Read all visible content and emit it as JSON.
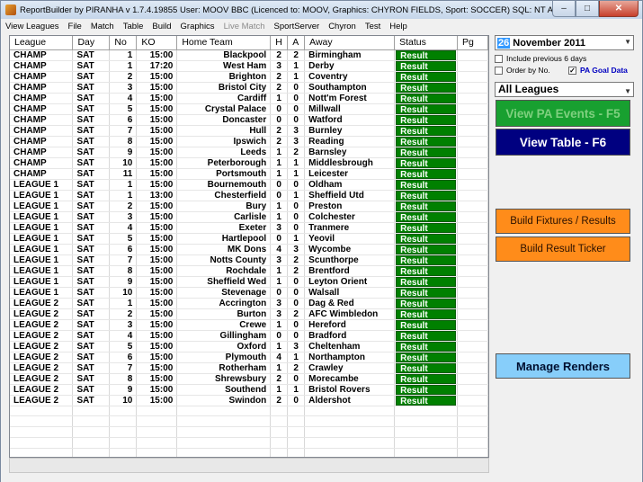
{
  "window": {
    "title": "ReportBuilder by PIRANHA v 1.7.4.19855     User: MOOV BBC   (Licenced to: MOOV, Graphics: CHYRON FIELDS, Sport: SOCCER)     SQL: NT Auth",
    "controls": {
      "minimize": "–",
      "maximize": "□",
      "close": "✕"
    }
  },
  "menu": [
    {
      "label": "View Leagues",
      "disabled": false
    },
    {
      "label": "File",
      "disabled": false
    },
    {
      "label": "Match",
      "disabled": false
    },
    {
      "label": "Table",
      "disabled": false
    },
    {
      "label": "Build",
      "disabled": false
    },
    {
      "label": "Graphics",
      "disabled": false
    },
    {
      "label": "Live Match",
      "disabled": true
    },
    {
      "label": "SportServer",
      "disabled": false
    },
    {
      "label": "Chyron",
      "disabled": false
    },
    {
      "label": "Test",
      "disabled": false
    },
    {
      "label": "Help",
      "disabled": false
    }
  ],
  "grid": {
    "headers": [
      "League",
      "Day",
      "No",
      "KO",
      "Home Team",
      "H",
      "A",
      "Away",
      "Status",
      "Pg"
    ],
    "rows": [
      [
        "CHAMP",
        "SAT",
        "1",
        "15:00",
        "Blackpool",
        "2",
        "2",
        "Birmingham",
        "Result",
        ""
      ],
      [
        "CHAMP",
        "SAT",
        "1",
        "17:20",
        "West Ham",
        "3",
        "1",
        "Derby",
        "Result",
        ""
      ],
      [
        "CHAMP",
        "SAT",
        "2",
        "15:00",
        "Brighton",
        "2",
        "1",
        "Coventry",
        "Result",
        ""
      ],
      [
        "CHAMP",
        "SAT",
        "3",
        "15:00",
        "Bristol City",
        "2",
        "0",
        "Southampton",
        "Result",
        ""
      ],
      [
        "CHAMP",
        "SAT",
        "4",
        "15:00",
        "Cardiff",
        "1",
        "0",
        "Nott'm Forest",
        "Result",
        ""
      ],
      [
        "CHAMP",
        "SAT",
        "5",
        "15:00",
        "Crystal Palace",
        "0",
        "0",
        "Millwall",
        "Result",
        ""
      ],
      [
        "CHAMP",
        "SAT",
        "6",
        "15:00",
        "Doncaster",
        "0",
        "0",
        "Watford",
        "Result",
        ""
      ],
      [
        "CHAMP",
        "SAT",
        "7",
        "15:00",
        "Hull",
        "2",
        "3",
        "Burnley",
        "Result",
        ""
      ],
      [
        "CHAMP",
        "SAT",
        "8",
        "15:00",
        "Ipswich",
        "2",
        "3",
        "Reading",
        "Result",
        ""
      ],
      [
        "CHAMP",
        "SAT",
        "9",
        "15:00",
        "Leeds",
        "1",
        "2",
        "Barnsley",
        "Result",
        ""
      ],
      [
        "CHAMP",
        "SAT",
        "10",
        "15:00",
        "Peterborough",
        "1",
        "1",
        "Middlesbrough",
        "Result",
        ""
      ],
      [
        "CHAMP",
        "SAT",
        "11",
        "15:00",
        "Portsmouth",
        "1",
        "1",
        "Leicester",
        "Result",
        ""
      ],
      [
        "LEAGUE 1",
        "SAT",
        "1",
        "15:00",
        "Bournemouth",
        "0",
        "0",
        "Oldham",
        "Result",
        ""
      ],
      [
        "LEAGUE 1",
        "SAT",
        "1",
        "13:00",
        "Chesterfield",
        "0",
        "1",
        "Sheffield Utd",
        "Result",
        ""
      ],
      [
        "LEAGUE 1",
        "SAT",
        "2",
        "15:00",
        "Bury",
        "1",
        "0",
        "Preston",
        "Result",
        ""
      ],
      [
        "LEAGUE 1",
        "SAT",
        "3",
        "15:00",
        "Carlisle",
        "1",
        "0",
        "Colchester",
        "Result",
        ""
      ],
      [
        "LEAGUE 1",
        "SAT",
        "4",
        "15:00",
        "Exeter",
        "3",
        "0",
        "Tranmere",
        "Result",
        ""
      ],
      [
        "LEAGUE 1",
        "SAT",
        "5",
        "15:00",
        "Hartlepool",
        "0",
        "1",
        "Yeovil",
        "Result",
        ""
      ],
      [
        "LEAGUE 1",
        "SAT",
        "6",
        "15:00",
        "MK Dons",
        "4",
        "3",
        "Wycombe",
        "Result",
        ""
      ],
      [
        "LEAGUE 1",
        "SAT",
        "7",
        "15:00",
        "Notts County",
        "3",
        "2",
        "Scunthorpe",
        "Result",
        ""
      ],
      [
        "LEAGUE 1",
        "SAT",
        "8",
        "15:00",
        "Rochdale",
        "1",
        "2",
        "Brentford",
        "Result",
        ""
      ],
      [
        "LEAGUE 1",
        "SAT",
        "9",
        "15:00",
        "Sheffield Wed",
        "1",
        "0",
        "Leyton Orient",
        "Result",
        ""
      ],
      [
        "LEAGUE 1",
        "SAT",
        "10",
        "15:00",
        "Stevenage",
        "0",
        "0",
        "Walsall",
        "Result",
        ""
      ],
      [
        "LEAGUE 2",
        "SAT",
        "1",
        "15:00",
        "Accrington",
        "3",
        "0",
        "Dag & Red",
        "Result",
        ""
      ],
      [
        "LEAGUE 2",
        "SAT",
        "2",
        "15:00",
        "Burton",
        "3",
        "2",
        "AFC Wimbledon",
        "Result",
        ""
      ],
      [
        "LEAGUE 2",
        "SAT",
        "3",
        "15:00",
        "Crewe",
        "1",
        "0",
        "Hereford",
        "Result",
        ""
      ],
      [
        "LEAGUE 2",
        "SAT",
        "4",
        "15:00",
        "Gillingham",
        "0",
        "0",
        "Bradford",
        "Result",
        ""
      ],
      [
        "LEAGUE 2",
        "SAT",
        "5",
        "15:00",
        "Oxford",
        "1",
        "3",
        "Cheltenham",
        "Result",
        ""
      ],
      [
        "LEAGUE 2",
        "SAT",
        "6",
        "15:00",
        "Plymouth",
        "4",
        "1",
        "Northampton",
        "Result",
        ""
      ],
      [
        "LEAGUE 2",
        "SAT",
        "7",
        "15:00",
        "Rotherham",
        "1",
        "2",
        "Crawley",
        "Result",
        ""
      ],
      [
        "LEAGUE 2",
        "SAT",
        "8",
        "15:00",
        "Shrewsbury",
        "2",
        "0",
        "Morecambe",
        "Result",
        ""
      ],
      [
        "LEAGUE 2",
        "SAT",
        "9",
        "15:00",
        "Southend",
        "1",
        "1",
        "Bristol Rovers",
        "Result",
        ""
      ],
      [
        "LEAGUE 2",
        "SAT",
        "10",
        "15:00",
        "Swindon",
        "2",
        "0",
        "Aldershot",
        "Result",
        ""
      ]
    ]
  },
  "panel": {
    "date_day": "26",
    "date_rest": "November  2011",
    "include_prev_label": "Include previous 6 days",
    "order_by_label": "Order by No.",
    "pa_goal_label": "PA Goal Data",
    "pa_goal_checked": "✓",
    "league_select": "All Leagues",
    "btn_pa_events": "View PA Events - F5",
    "btn_view_table": "View Table - F6",
    "btn_build_fixtures": "Build Fixtures / Results",
    "btn_build_ticker": "Build Result Ticker",
    "btn_manage_renders": "Manage Renders",
    "dropdown_arrow": "▼"
  },
  "colors": {
    "result_green": "#008000",
    "pa_events_bg": "#18a030",
    "view_table_bg": "#000080",
    "orange_btn": "#ff8c1a",
    "renders_bg": "#87cefa"
  }
}
